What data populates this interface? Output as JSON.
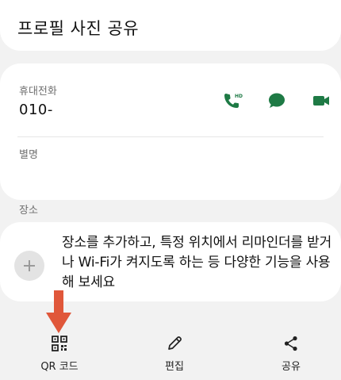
{
  "header": {
    "title": "프로필 사진 공유"
  },
  "contact": {
    "phone_label": "휴대전화",
    "phone_value": "010-",
    "nickname_label": "별명",
    "actions": [
      "hd-call-icon",
      "message-icon",
      "video-call-icon"
    ]
  },
  "location": {
    "section_label": "장소",
    "prompt": "장소를 추가하고, 특정 위치에서 리마인더를 받거나 Wi-Fi가 켜지도록 하는 등 다양한 기능을 사용해 보세요"
  },
  "bottom_bar": {
    "qr_label": "QR 코드",
    "edit_label": "편집",
    "share_label": "공유"
  },
  "colors": {
    "accent": "#1e7a45",
    "arrow": "#e0573a"
  }
}
